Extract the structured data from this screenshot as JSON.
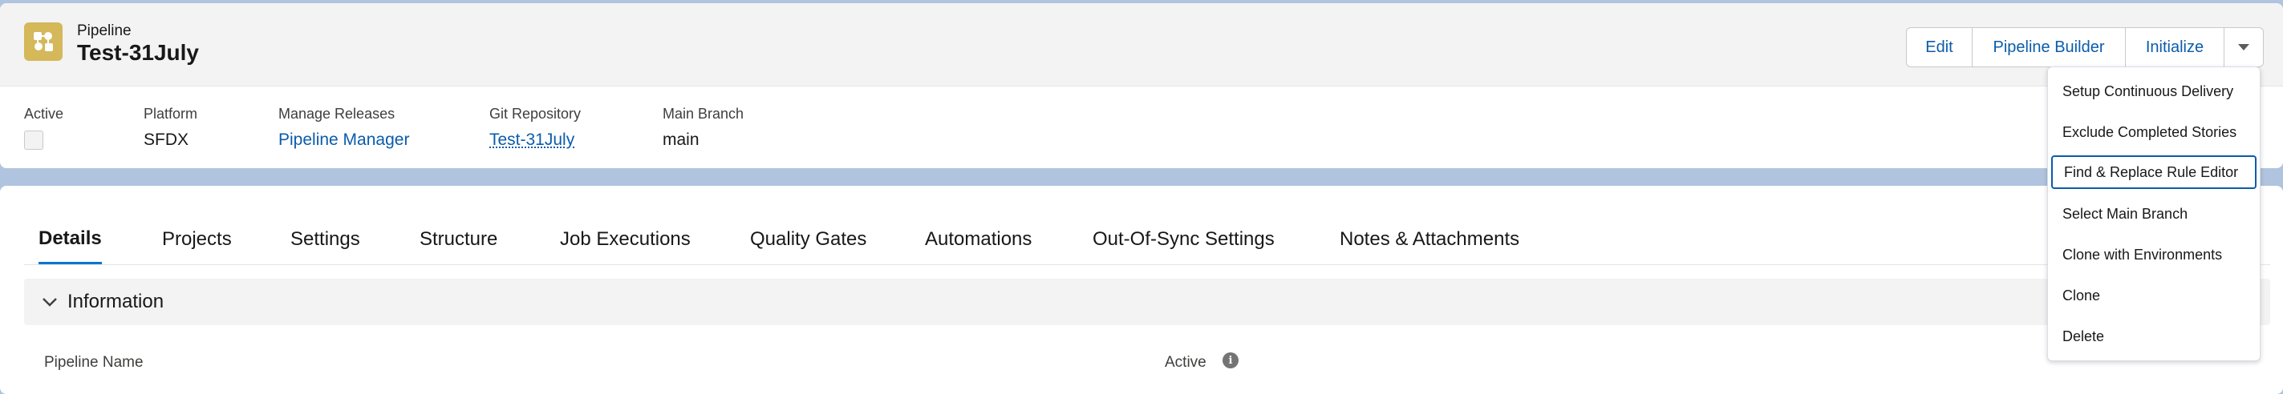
{
  "header": {
    "object_type": "Pipeline",
    "record_title": "Test-31July",
    "icon": "pipeline-icon",
    "icon_color": "#d4b85a"
  },
  "actions": {
    "edit": "Edit",
    "pipeline_builder": "Pipeline Builder",
    "initialize": "Initialize",
    "more_icon": "chevron-down-icon"
  },
  "fields": {
    "active_label": "Active",
    "platform_label": "Platform",
    "platform_value": "SFDX",
    "manage_releases_label": "Manage Releases",
    "manage_releases_value": "Pipeline Manager",
    "git_repo_label": "Git Repository",
    "git_repo_value": "Test-31July",
    "main_branch_label": "Main Branch",
    "main_branch_value": "main"
  },
  "tabs": [
    {
      "label": "Details",
      "active": true
    },
    {
      "label": "Projects"
    },
    {
      "label": "Settings"
    },
    {
      "label": "Structure"
    },
    {
      "label": "Job Executions"
    },
    {
      "label": "Quality Gates"
    },
    {
      "label": "Automations"
    },
    {
      "label": "Out-Of-Sync Settings"
    },
    {
      "label": "Notes & Attachments"
    }
  ],
  "section": {
    "title": "Information",
    "pipeline_name_label": "Pipeline Name",
    "active_label": "Active"
  },
  "menu": {
    "items": [
      "Setup Continuous Delivery",
      "Exclude Completed Stories",
      "Find & Replace Rule Editor",
      "Select Main Branch",
      "Clone with Environments",
      "Clone",
      "Delete"
    ],
    "focused_index": 2
  },
  "colors": {
    "link": "#0b5cab",
    "active_tab": "#0176d3",
    "page_bg": "#b0c4df"
  }
}
